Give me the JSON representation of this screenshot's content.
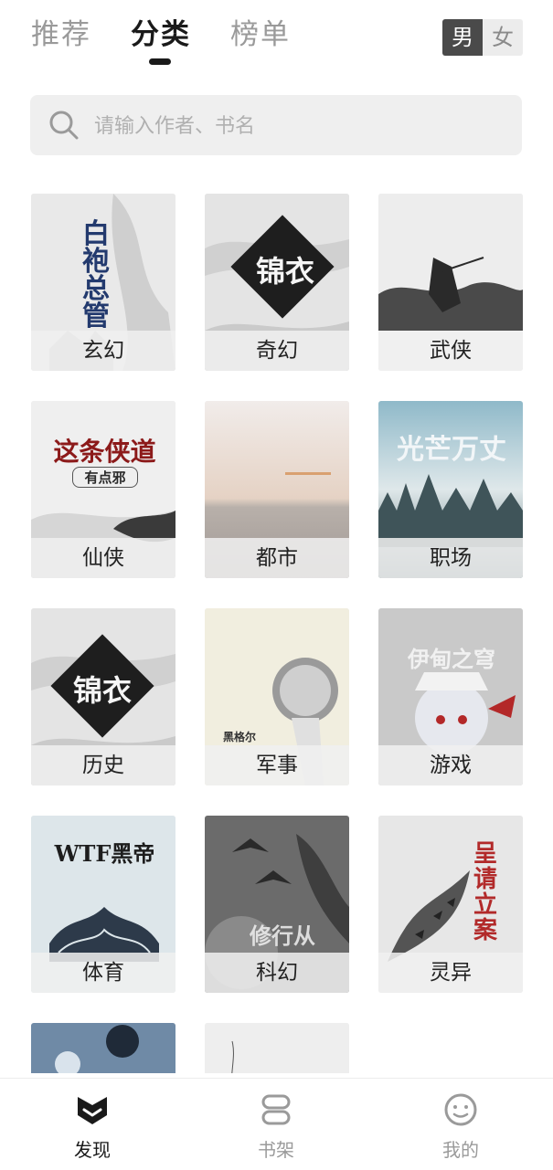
{
  "top_tabs": [
    {
      "label": "推荐",
      "active": false
    },
    {
      "label": "分类",
      "active": true
    },
    {
      "label": "榜单",
      "active": false
    }
  ],
  "gender_toggle": {
    "male": "男",
    "female": "女",
    "selected": "男"
  },
  "search": {
    "placeholder": "请输入作者、书名",
    "value": ""
  },
  "categories": [
    {
      "label": "玄幻",
      "cover_text": "白袍总管"
    },
    {
      "label": "奇幻",
      "cover_text": "锦衣"
    },
    {
      "label": "武侠",
      "cover_text": ""
    },
    {
      "label": "仙侠",
      "cover_text": "这条侠道",
      "cover_subtext": "有点邪"
    },
    {
      "label": "都市",
      "cover_text": ""
    },
    {
      "label": "职场",
      "cover_text": "光芒万丈"
    },
    {
      "label": "历史",
      "cover_text": "锦衣"
    },
    {
      "label": "军事",
      "cover_text": "黑格尔"
    },
    {
      "label": "游戏",
      "cover_text": "伊甸之穹"
    },
    {
      "label": "体育",
      "cover_text": "WTF黑帝"
    },
    {
      "label": "科幻",
      "cover_text": "修行从"
    },
    {
      "label": "灵异",
      "cover_text": "呈请立案"
    },
    {
      "label": "",
      "cover_text": ""
    },
    {
      "label": "",
      "cover_text": ""
    }
  ],
  "bottom_nav": [
    {
      "label": "发现",
      "icon": "discover-icon",
      "active": true
    },
    {
      "label": "书架",
      "icon": "bookshelf-icon",
      "active": false
    },
    {
      "label": "我的",
      "icon": "profile-icon",
      "active": false
    }
  ],
  "colors": {
    "active_text": "#1a1a1a",
    "inactive_text": "#9a9a9a",
    "search_bg": "#efefef",
    "toggle_selected": "#4a4a4a"
  }
}
